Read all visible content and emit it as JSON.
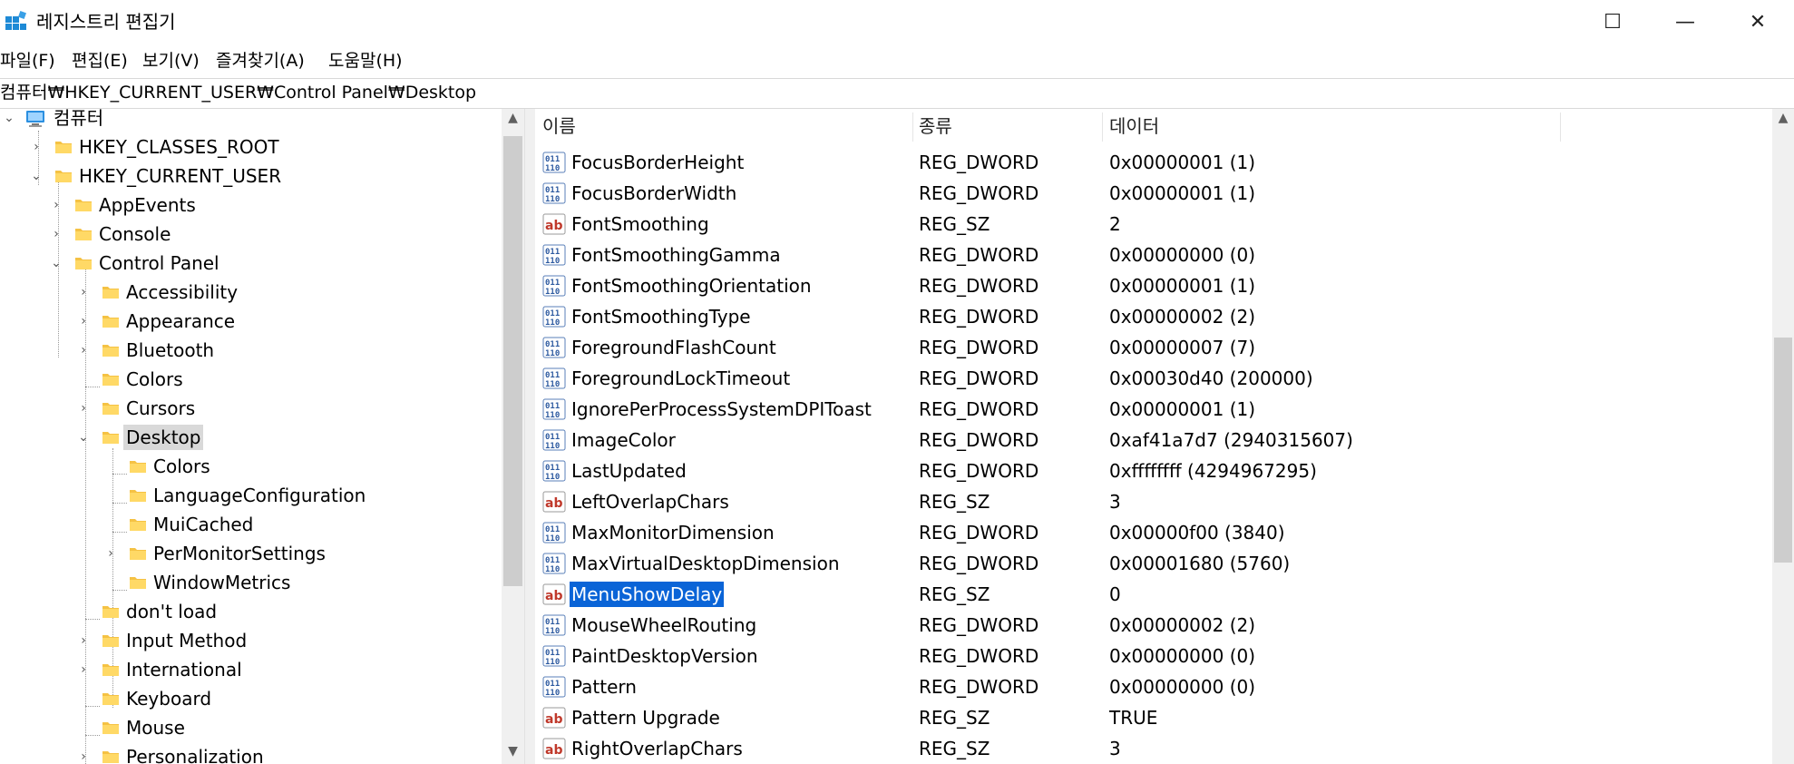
{
  "window": {
    "title": "레지스트리 편집기",
    "minimize_glyph": "—",
    "maximize_glyph": "☐",
    "close_glyph": "✕"
  },
  "menu": [
    "파일(F)",
    "편집(E)",
    "보기(V)",
    "즐겨찾기(A)",
    "도움말(H)"
  ],
  "address": "컴퓨터₩HKEY_CURRENT_USER₩Control Panel₩Desktop",
  "tree": {
    "root": "컴퓨터",
    "items": [
      {
        "label": "HKEY_CLASSES_ROOT",
        "toggle": "›"
      },
      {
        "label": "HKEY_CURRENT_USER",
        "toggle": "⌄"
      },
      {
        "label": "AppEvents",
        "toggle": "›"
      },
      {
        "label": "Console",
        "toggle": "›"
      },
      {
        "label": "Control Panel",
        "toggle": "⌄"
      },
      {
        "label": "Accessibility",
        "toggle": "›"
      },
      {
        "label": "Appearance",
        "toggle": "›"
      },
      {
        "label": "Bluetooth",
        "toggle": "›"
      },
      {
        "label": "Colors",
        "toggle": ""
      },
      {
        "label": "Cursors",
        "toggle": "›"
      },
      {
        "label": "Desktop",
        "toggle": "⌄"
      },
      {
        "label": "Colors",
        "toggle": ""
      },
      {
        "label": "LanguageConfiguration",
        "toggle": ""
      },
      {
        "label": "MuiCached",
        "toggle": ""
      },
      {
        "label": "PerMonitorSettings",
        "toggle": "›"
      },
      {
        "label": "WindowMetrics",
        "toggle": ""
      },
      {
        "label": "don't load",
        "toggle": ""
      },
      {
        "label": "Input Method",
        "toggle": "›"
      },
      {
        "label": "International",
        "toggle": "›"
      },
      {
        "label": "Keyboard",
        "toggle": ""
      },
      {
        "label": "Mouse",
        "toggle": ""
      },
      {
        "label": "Personalization",
        "toggle": "›"
      }
    ]
  },
  "columns": {
    "name": "이름",
    "type": "종류",
    "data": "데이터"
  },
  "values": [
    {
      "name": "FocusBorderHeight",
      "type": "REG_DWORD",
      "data": "0x00000001 (1)",
      "icon": "binary-value-icon"
    },
    {
      "name": "FocusBorderWidth",
      "type": "REG_DWORD",
      "data": "0x00000001 (1)",
      "icon": "binary-value-icon"
    },
    {
      "name": "FontSmoothing",
      "type": "REG_SZ",
      "data": "2",
      "icon": "string-value-icon"
    },
    {
      "name": "FontSmoothingGamma",
      "type": "REG_DWORD",
      "data": "0x00000000 (0)",
      "icon": "binary-value-icon"
    },
    {
      "name": "FontSmoothingOrientation",
      "type": "REG_DWORD",
      "data": "0x00000001 (1)",
      "icon": "binary-value-icon"
    },
    {
      "name": "FontSmoothingType",
      "type": "REG_DWORD",
      "data": "0x00000002 (2)",
      "icon": "binary-value-icon"
    },
    {
      "name": "ForegroundFlashCount",
      "type": "REG_DWORD",
      "data": "0x00000007 (7)",
      "icon": "binary-value-icon"
    },
    {
      "name": "ForegroundLockTimeout",
      "type": "REG_DWORD",
      "data": "0x00030d40 (200000)",
      "icon": "binary-value-icon"
    },
    {
      "name": "IgnorePerProcessSystemDPIToast",
      "type": "REG_DWORD",
      "data": "0x00000001 (1)",
      "icon": "binary-value-icon"
    },
    {
      "name": "ImageColor",
      "type": "REG_DWORD",
      "data": "0xaf41a7d7 (2940315607)",
      "icon": "binary-value-icon"
    },
    {
      "name": "LastUpdated",
      "type": "REG_DWORD",
      "data": "0xffffffff (4294967295)",
      "icon": "binary-value-icon"
    },
    {
      "name": "LeftOverlapChars",
      "type": "REG_SZ",
      "data": "3",
      "icon": "string-value-icon"
    },
    {
      "name": "MaxMonitorDimension",
      "type": "REG_DWORD",
      "data": "0x00000f00 (3840)",
      "icon": "binary-value-icon"
    },
    {
      "name": "MaxVirtualDesktopDimension",
      "type": "REG_DWORD",
      "data": "0x00001680 (5760)",
      "icon": "binary-value-icon"
    },
    {
      "name": "MenuShowDelay",
      "type": "REG_SZ",
      "data": "0",
      "icon": "string-value-icon",
      "selected": true
    },
    {
      "name": "MouseWheelRouting",
      "type": "REG_DWORD",
      "data": "0x00000002 (2)",
      "icon": "binary-value-icon"
    },
    {
      "name": "PaintDesktopVersion",
      "type": "REG_DWORD",
      "data": "0x00000000 (0)",
      "icon": "binary-value-icon"
    },
    {
      "name": "Pattern",
      "type": "REG_DWORD",
      "data": "0x00000000 (0)",
      "icon": "binary-value-icon"
    },
    {
      "name": "Pattern Upgrade",
      "type": "REG_SZ",
      "data": "TRUE",
      "icon": "string-value-icon"
    },
    {
      "name": "RightOverlapChars",
      "type": "REG_SZ",
      "data": "3",
      "icon": "string-value-icon"
    }
  ],
  "colors": {
    "selection": "#0a64d7",
    "folder": "#f5c244",
    "tree_selection": "#d9d9d9"
  }
}
